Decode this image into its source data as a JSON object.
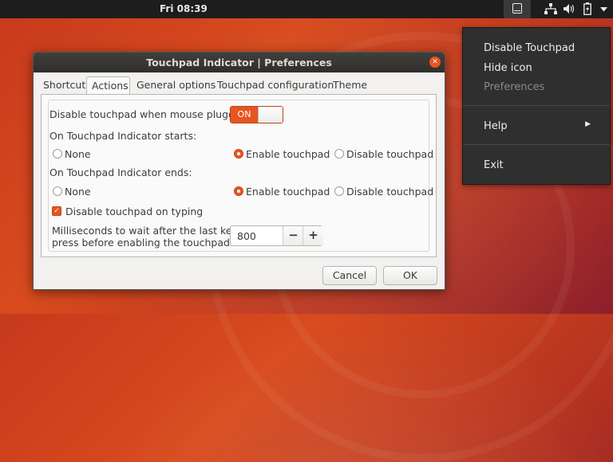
{
  "topbar": {
    "clock": "Fri 08:39",
    "tray_icons": [
      "touchpad-indicator-icon",
      "network-icon",
      "volume-icon",
      "battery-icon",
      "system-menu-chevron-icon"
    ]
  },
  "menu": {
    "disable_touchpad": "Disable Touchpad",
    "hide_icon": "Hide icon",
    "preferences": "Preferences",
    "help": "Help",
    "exit": "Exit"
  },
  "dialog": {
    "title": "Touchpad Indicator | Preferences",
    "tabs": [
      "Shortcut",
      "Actions",
      "General options",
      "Touchpad configuration",
      "Theme"
    ],
    "active_tab": "Actions",
    "disable_when_mouse_label": "Disable touchpad when mouse plugged",
    "switch_state": "ON",
    "starts_label": "On Touchpad Indicator starts:",
    "ends_label": "On Touchpad Indicator ends:",
    "radio_options": [
      "None",
      "Enable touchpad",
      "Disable touchpad"
    ],
    "starts_selected": "Enable touchpad",
    "ends_selected": "Enable touchpad",
    "disable_on_typing_label": "Disable touchpad on typing",
    "disable_on_typing_checked": true,
    "ms_label_line1": "Milliseconds to wait after the last key",
    "ms_label_line2": "press before enabling the touchpad:",
    "ms_value": "800",
    "minus": "−",
    "plus": "+",
    "cancel": "Cancel",
    "ok": "OK"
  },
  "colors": {
    "accent": "#e95420",
    "menu_bg": "#2f2f2f",
    "titlebar_bg": "#3a3835",
    "dialog_bg": "#f2f1f0"
  }
}
